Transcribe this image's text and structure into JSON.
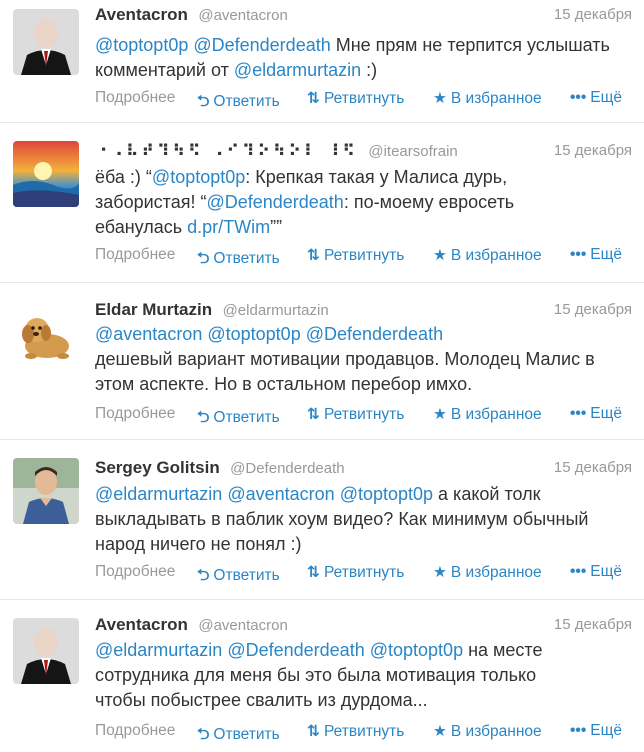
{
  "actions": {
    "more": "Подробнее",
    "reply": "Ответить",
    "retweet": "Ретвитнуть",
    "favorite": "В избранное",
    "etc": "Ещё"
  },
  "icons": {
    "reply": "reply-arrow-icon",
    "retweet": "retweet-icon",
    "favorite": "star-icon",
    "etc": "dots-icon"
  },
  "colors": {
    "link": "#2a86c6",
    "meta": "#999999",
    "text": "#333333"
  },
  "tweets": [
    {
      "name": "Aventacron",
      "handle": "@aventacron",
      "time": "15 декабря",
      "parts": [
        "@toptopt0p",
        " ",
        "@Defenderdeath",
        " Мне прям не терпится услышать комментарий от ",
        "@eldarmurtazin",
        " :)"
      ]
    },
    {
      "name": "⠐⠠⠧⠞⠹⠳⠫ ⠠⠊⠹⠕⠳⠕⠇ ⠸⠫",
      "handle": "@itearsofrain",
      "time": "15 декабря",
      "parts": [
        "ёба :) “",
        "@toptopt0p",
        ": Крепкая такая у Малиса дурь, забористая! “",
        "@Defenderdeath",
        ": по-моему евросеть ебанулась ",
        "d.pr/TWim",
        "””"
      ]
    },
    {
      "name": "Eldar Murtazin",
      "handle": "@eldarmurtazin",
      "time": "15 декабря",
      "parts": [
        "@aventacron",
        " ",
        "@toptopt0p",
        " ",
        "@Defenderdeath",
        " дешевый вариант мотивации продавцов. Молодец Малис в этом аспекте. Но в остальном перебор имхо."
      ]
    },
    {
      "name": "Sergey Golitsin",
      "handle": "@Defenderdeath",
      "time": "15 декабря",
      "parts": [
        "@eldarmurtazin",
        " ",
        "@aventacron",
        " ",
        "@toptopt0p",
        " а какой толк выкладывать в паблик хоум видео? Как минимум обычный народ ничего не понял :)"
      ]
    },
    {
      "name": "Aventacron",
      "handle": "@aventacron",
      "time": "15 декабря",
      "parts": [
        "@eldarmurtazin",
        " ",
        "@Defenderdeath",
        " ",
        "@toptopt0p",
        " на месте сотрудника для меня бы это была мотивация только чтобы побыстрее свалить из дурдома..."
      ]
    }
  ]
}
